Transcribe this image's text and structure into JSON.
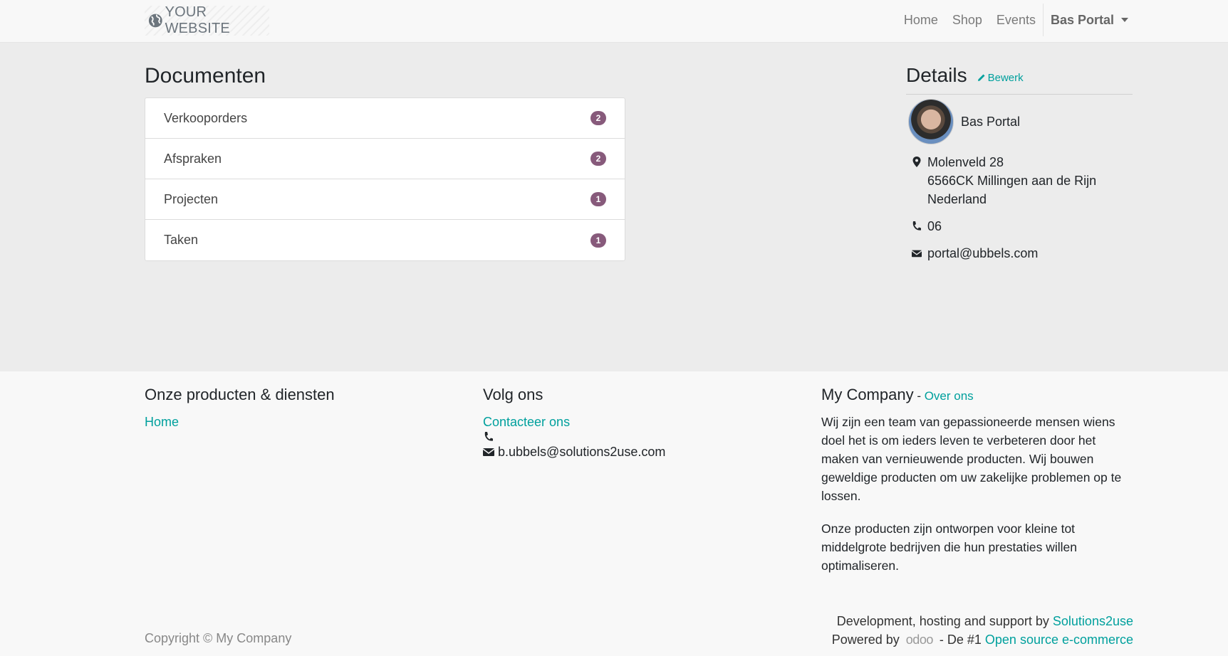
{
  "navbar": {
    "brand": "YOUR WEBSITE",
    "links": [
      "Home",
      "Shop",
      "Events"
    ],
    "user": "Bas Portal"
  },
  "documents": {
    "title": "Documenten",
    "items": [
      {
        "label": "Verkooporders",
        "count": "2"
      },
      {
        "label": "Afspraken",
        "count": "2"
      },
      {
        "label": "Projecten",
        "count": "1"
      },
      {
        "label": "Taken",
        "count": "1"
      }
    ]
  },
  "details": {
    "title": "Details",
    "edit_label": "Bewerk",
    "name": "Bas Portal",
    "address_line1": "Molenveld 28",
    "address_line2": "6566CK Millingen aan de Rijn",
    "address_line3": "Nederland",
    "phone": "06",
    "email": "portal@ubbels.com"
  },
  "footer": {
    "col1": {
      "title": "Onze producten & diensten",
      "link": "Home"
    },
    "col2": {
      "title": "Volg ons",
      "link": "Contacteer ons",
      "email": "b.ubbels@solutions2use.com"
    },
    "col3": {
      "title": "My Company",
      "sep": " - ",
      "link": "Over ons",
      "para1": "Wij zijn een team van gepassioneerde mensen wiens doel het is om ieders leven te verbeteren door het maken van vernieuwende producten. Wij bouwen geweldige producten om uw zakelijke problemen op te lossen.",
      "para2": "Onze producten zijn ontworpen voor kleine tot middelgrote bedrijven die hun prestaties willen optimaliseren."
    },
    "copyright": "Copyright © My Company",
    "credits_text": "Development, hosting and support by",
    "credits_link": "Solutions2use",
    "powered_text": "Powered by",
    "odoo_logo": "odoo",
    "powered_suffix": "- De #1",
    "powered_link": "Open source e-commerce"
  },
  "colors": {
    "accent": "#00a09d",
    "badge": "#875a7b"
  }
}
